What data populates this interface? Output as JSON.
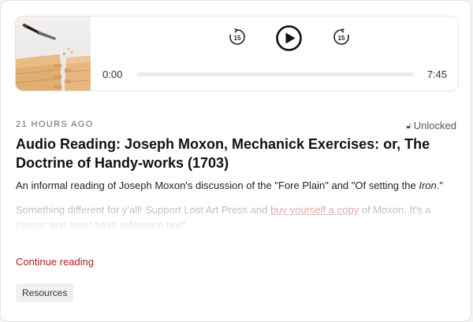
{
  "player": {
    "thumbnail_alt": "chisel and wooden boards",
    "current_time": "0:00",
    "duration": "7:45",
    "progress": 0,
    "rewind_seconds": "15",
    "forward_seconds": "15",
    "play_state": "paused"
  },
  "post": {
    "date": "21 HOURS AGO",
    "access": "Unlocked",
    "title": "Audio Reading: Joseph Moxon, Mechanick Exercises: or, The Doctrine of Handy-works (1703)",
    "excerpt_1_pre": "An informal reading of Joseph Moxon's discussion of the \"Fore Plain\" and \"Of setting the ",
    "excerpt_1_em": "Iron",
    "excerpt_1_post": ".\"",
    "excerpt_2_pre": "Something different for y'all! Support Lost Art Press and ",
    "excerpt_2_link": "buy yourself a copy",
    "excerpt_2_post": " of Moxon. It's a classic and must-have reference text!",
    "continue_label": "Continue reading",
    "tag_label": "Resources"
  },
  "colors": {
    "accent": "#b01d1d",
    "link": "#b32f2f",
    "card_bg": "#ffffff",
    "page_bg": "#f4f4f5",
    "tag_bg": "#f0f0f2"
  },
  "icons": {
    "rewind": "rewind-15-icon",
    "play": "play-icon",
    "forward": "forward-15-icon",
    "lock": "lock-icon"
  }
}
